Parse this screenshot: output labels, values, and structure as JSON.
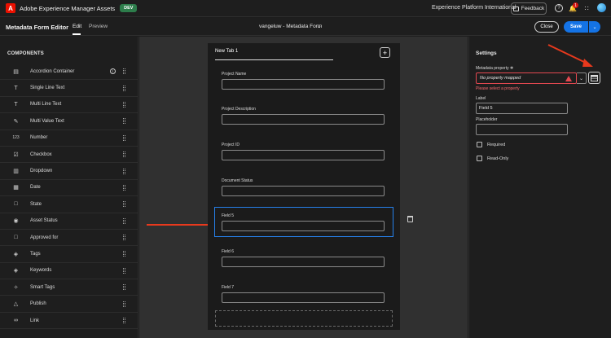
{
  "topbar": {
    "logo_letter": "A",
    "app_title": "Adobe Experience Manager Assets",
    "env_badge": "DEV",
    "org_name": "Experience Platform International",
    "feedback_label": "Feedback",
    "notification_count": "1"
  },
  "header": {
    "editor_title": "Metadata Form Editor",
    "tab_edit": "Edit",
    "tab_preview": "Preview",
    "form_title": "vangeluw - Metadata Form",
    "close_label": "Close",
    "save_label": "Save"
  },
  "components": {
    "heading": "COMPONENTS",
    "items": [
      {
        "label": "Accordion Container",
        "icon": "accordion-icon"
      },
      {
        "label": "Single Line Text",
        "icon": "text-icon"
      },
      {
        "label": "Multi Line Text",
        "icon": "text-icon"
      },
      {
        "label": "Multi Value Text",
        "icon": "brush-icon"
      },
      {
        "label": "Number",
        "icon": "number-icon"
      },
      {
        "label": "Checkbox",
        "icon": "checkbox-icon"
      },
      {
        "label": "Dropdown",
        "icon": "dropdown-icon"
      },
      {
        "label": "Date",
        "icon": "calendar-icon"
      },
      {
        "label": "State",
        "icon": "state-icon"
      },
      {
        "label": "Asset Status",
        "icon": "status-icon"
      },
      {
        "label": "Approved for",
        "icon": "approved-icon"
      },
      {
        "label": "Tags",
        "icon": "tag-icon"
      },
      {
        "label": "Keywords",
        "icon": "tag-icon"
      },
      {
        "label": "Smart Tags",
        "icon": "wand-icon"
      },
      {
        "label": "Publish",
        "icon": "publish-icon"
      },
      {
        "label": "Link",
        "icon": "link-icon"
      }
    ]
  },
  "canvas": {
    "tab_label": "New Tab 1",
    "fields": [
      {
        "label": "Project Name"
      },
      {
        "label": "Project Description"
      },
      {
        "label": "Project ID"
      },
      {
        "label": "Document Status"
      },
      {
        "label": "Field 5"
      },
      {
        "label": "Field 6"
      },
      {
        "label": "Field 7"
      }
    ]
  },
  "settings": {
    "title": "Settings",
    "metadata_property_label": "Metadata property",
    "metadata_property_placeholder": "No property mapped",
    "error_text": "Please select a property",
    "label_label": "Label",
    "label_value": "Field 5",
    "placeholder_label": "Placeholder",
    "placeholder_value": "",
    "required_label": "Required",
    "readonly_label": "Read-Only"
  },
  "colors": {
    "accent": "#1473e6",
    "error": "#e34850",
    "annotation_arrow": "#e8391d",
    "env_badge": "#2d7d4b"
  }
}
